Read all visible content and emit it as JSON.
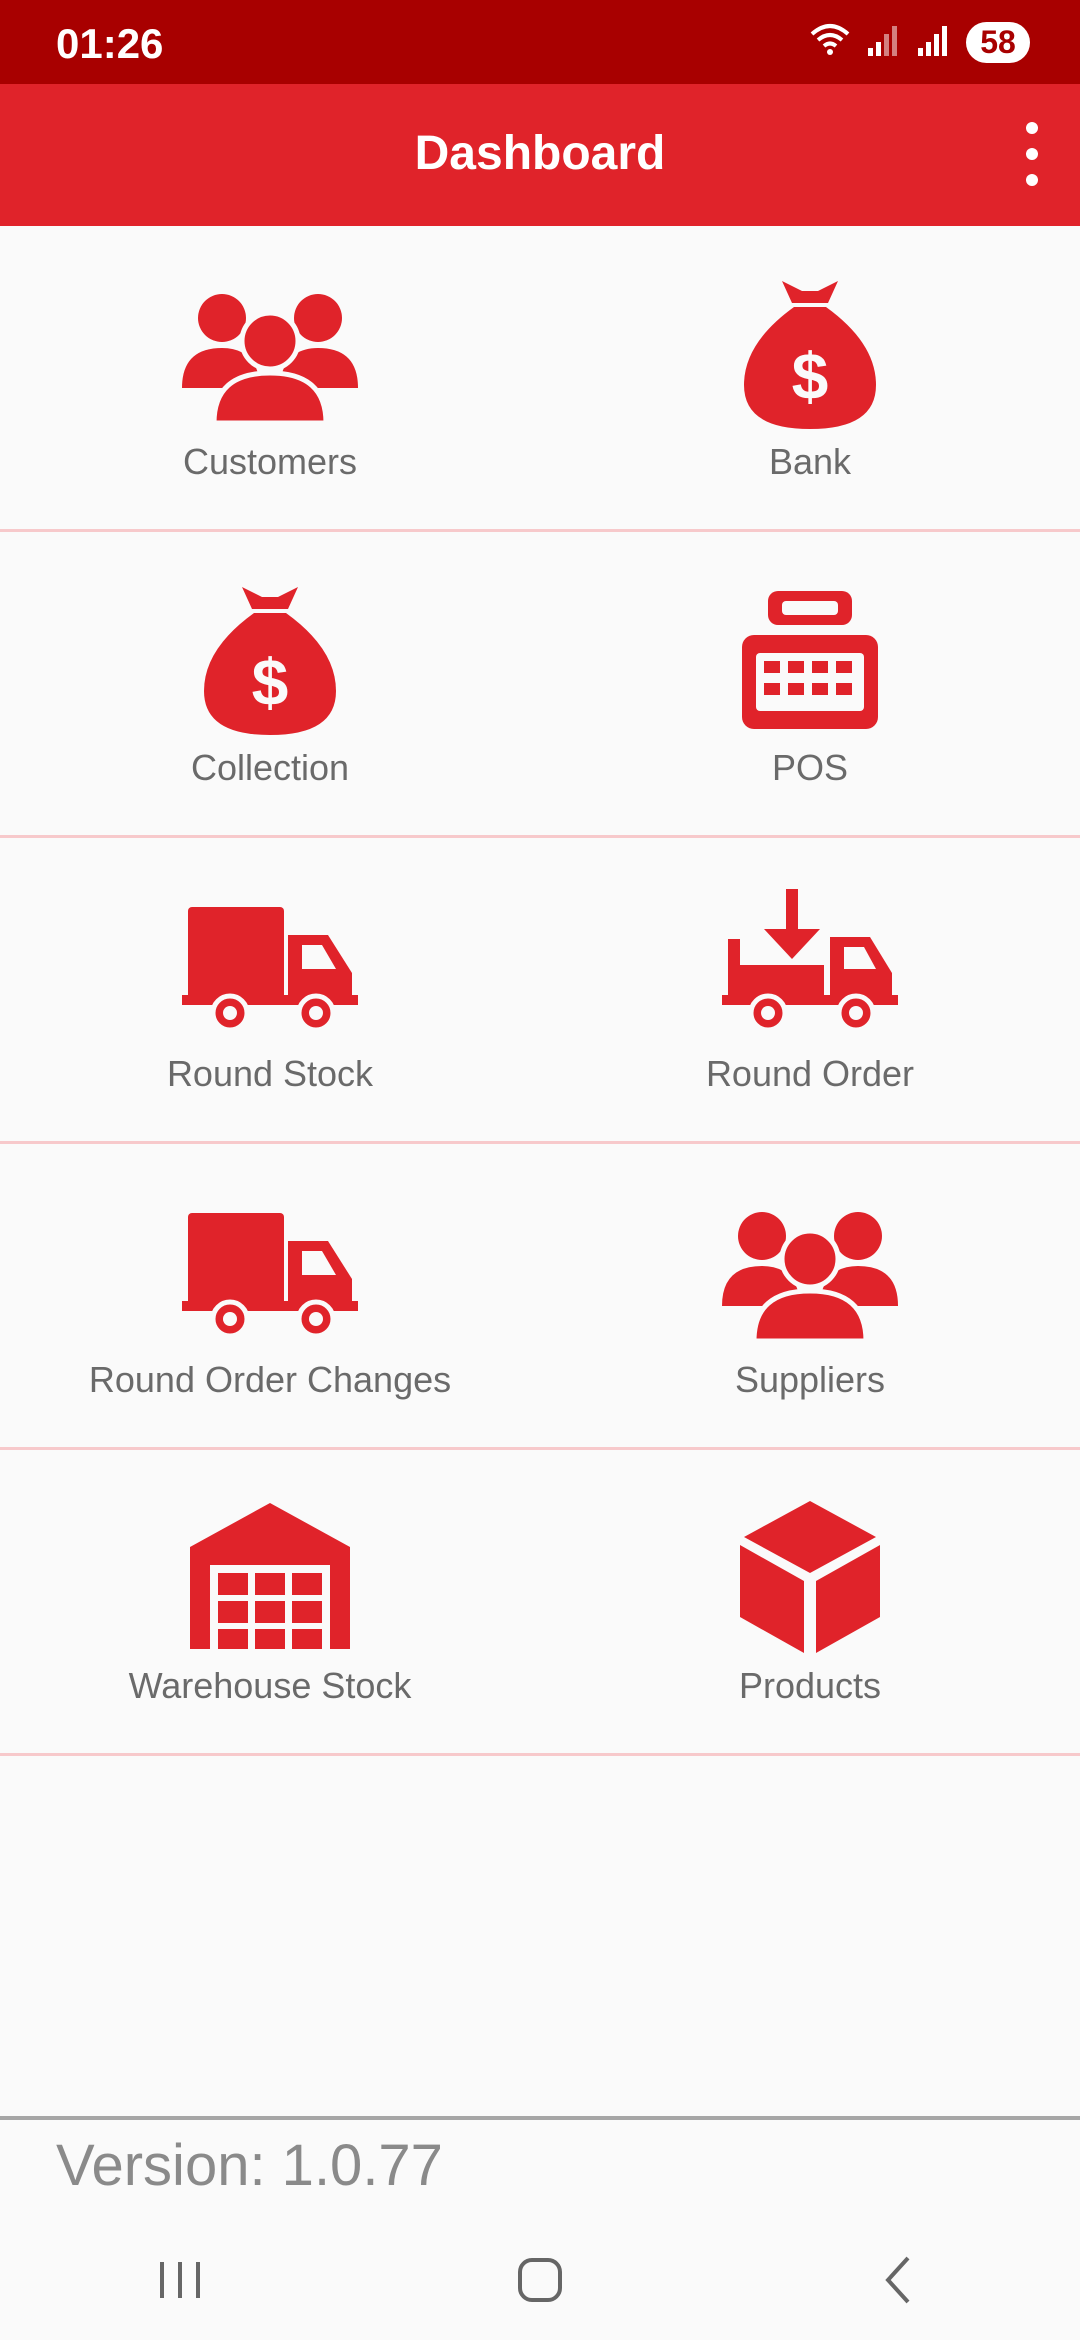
{
  "status_bar": {
    "time": "01:26",
    "battery": "58",
    "icons": [
      "wifi-icon",
      "signal-icon",
      "signal-icon",
      "battery-icon"
    ]
  },
  "app_bar": {
    "title": "Dashboard",
    "menu_icon": "more-vertical-icon"
  },
  "tiles": [
    {
      "label": "Customers",
      "icon": "users-icon"
    },
    {
      "label": "Bank",
      "icon": "money-bag-icon"
    },
    {
      "label": "Collection",
      "icon": "money-bag-icon"
    },
    {
      "label": "POS",
      "icon": "cash-register-icon"
    },
    {
      "label": "Round Stock",
      "icon": "truck-icon"
    },
    {
      "label": "Round Order",
      "icon": "truck-arrow-icon"
    },
    {
      "label": "Round Order Changes",
      "icon": "truck-icon"
    },
    {
      "label": "Suppliers",
      "icon": "users-icon"
    },
    {
      "label": "Warehouse Stock",
      "icon": "warehouse-icon"
    },
    {
      "label": "Products",
      "icon": "box-icon"
    }
  ],
  "footer": {
    "version": "Version: 1.0.77"
  },
  "nav": {
    "items": [
      "recent-apps-icon",
      "home-icon",
      "back-icon"
    ]
  },
  "colors": {
    "accent": "#e0232a",
    "status": "#a80000",
    "label": "#6a6a6a"
  }
}
